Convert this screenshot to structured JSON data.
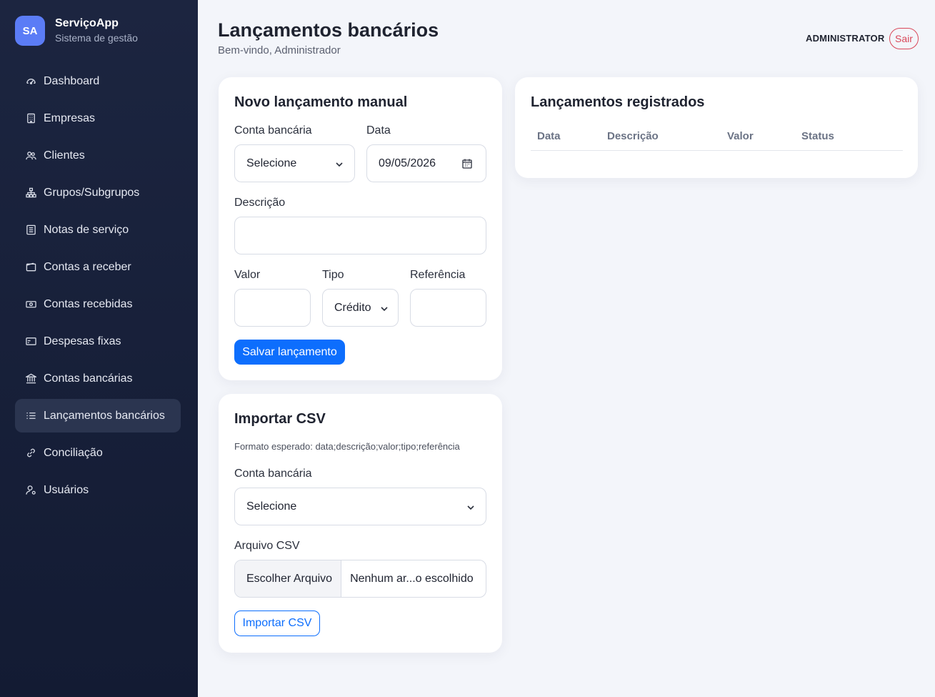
{
  "brand": {
    "initials": "SA",
    "name": "ServiçoApp",
    "subtitle": "Sistema de gestão"
  },
  "sidebar": {
    "items": [
      {
        "label": "Dashboard",
        "icon": "dashboard-icon"
      },
      {
        "label": "Empresas",
        "icon": "building-icon"
      },
      {
        "label": "Clientes",
        "icon": "users-icon"
      },
      {
        "label": "Grupos/Subgrupos",
        "icon": "hierarchy-icon"
      },
      {
        "label": "Notas de serviço",
        "icon": "document-icon"
      },
      {
        "label": "Contas a receber",
        "icon": "wallet-icon"
      },
      {
        "label": "Contas recebidas",
        "icon": "cash-icon"
      },
      {
        "label": "Despesas fixas",
        "icon": "card-icon"
      },
      {
        "label": "Contas bancárias",
        "icon": "bank-icon"
      },
      {
        "label": "Lançamentos bancários",
        "icon": "list-icon",
        "active": true
      },
      {
        "label": "Conciliação",
        "icon": "link-icon"
      },
      {
        "label": "Usuários",
        "icon": "user-gear-icon"
      }
    ]
  },
  "header": {
    "title": "Lançamentos bancários",
    "subtitle": "Bem-vindo, Administrador",
    "user": "ADMINISTRATOR",
    "logout_label": "Sair"
  },
  "manual_form": {
    "title": "Novo lançamento manual",
    "account_label": "Conta bancária",
    "account_value": "Selecione",
    "date_label": "Data",
    "date_value": "09/05/2026",
    "description_label": "Descrição",
    "description_value": "",
    "value_label": "Valor",
    "value_value": "",
    "type_label": "Tipo",
    "type_value": "Crédito",
    "reference_label": "Referência",
    "reference_value": "",
    "save_label": "Salvar lançamento"
  },
  "csv_form": {
    "title": "Importar CSV",
    "hint": "Formato esperado: data;descrição;valor;tipo;referência",
    "account_label": "Conta bancária",
    "account_value": "Selecione",
    "file_label": "Arquivo CSV",
    "file_button": "Escolher Arquivo",
    "file_name": "Nenhum ar...o escolhido",
    "import_label": "Importar CSV"
  },
  "records": {
    "title": "Lançamentos registrados",
    "columns": [
      "Data",
      "Descrição",
      "Valor",
      "Status"
    ],
    "rows": []
  },
  "colors": {
    "primary": "#0d6efd",
    "sidebar_bg": "#1c2540",
    "danger": "#d9485a",
    "brand": "#5b7cf6"
  }
}
